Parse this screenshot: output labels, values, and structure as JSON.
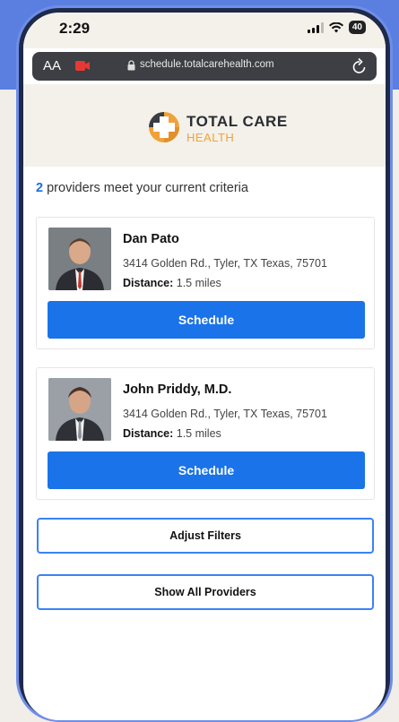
{
  "status_bar": {
    "time": "2:29",
    "battery": "40"
  },
  "browser": {
    "text_size_label": "AA",
    "url": "schedule.totalcarehealth.com"
  },
  "logo": {
    "line1": "TOTAL CARE",
    "line2": "HEALTH"
  },
  "results": {
    "count": "2",
    "text": " providers meet your current criteria"
  },
  "providers": [
    {
      "name": "Dan Pato",
      "address": "3414 Golden Rd., Tyler, TX Texas, 75701",
      "distance_label": "Distance:",
      "distance_value": " 1.5 miles",
      "button_label": "Schedule"
    },
    {
      "name": "John Priddy, M.D.",
      "address": "3414 Golden Rd., Tyler, TX Texas, 75701",
      "distance_label": "Distance:",
      "distance_value": " 1.5 miles",
      "button_label": "Schedule"
    }
  ],
  "actions": {
    "adjust_filters": "Adjust Filters",
    "show_all": "Show All Providers"
  },
  "colors": {
    "primary": "#1a73e8",
    "outline": "#3b82f6",
    "logo_orange": "#f0a23a",
    "frame_blue": "#5a7fe0"
  },
  "icons": [
    "camera-icon",
    "lock-icon",
    "reload-icon",
    "signal-icon",
    "wifi-icon",
    "battery-icon"
  ]
}
